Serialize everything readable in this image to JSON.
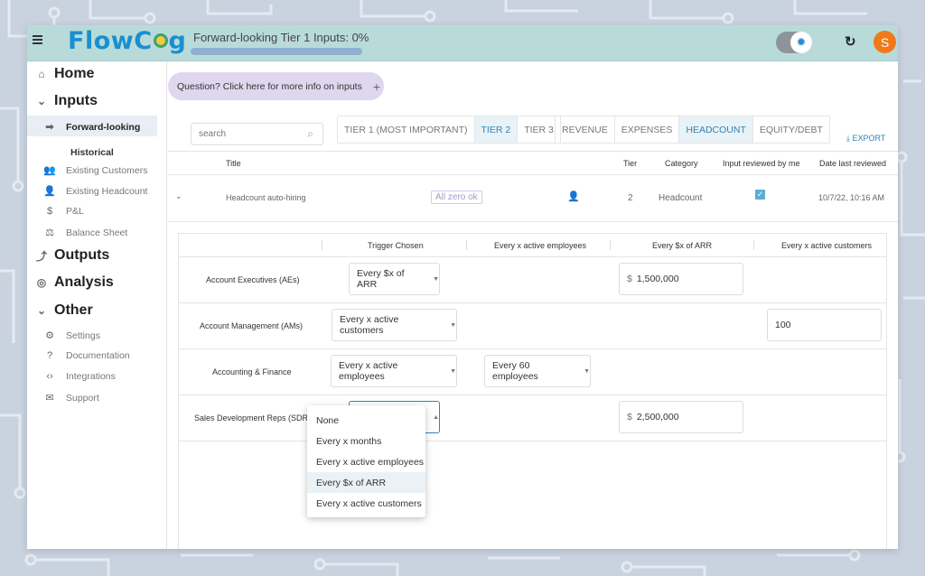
{
  "app": {
    "logo": "FlowCog",
    "progress_title": "Forward-looking Tier 1 Inputs: 0%",
    "progress_value": 0,
    "avatar_initial": "S",
    "icons": {
      "menu": "hamburger-icon",
      "theme": "sun-icon",
      "refresh": "refresh-icon"
    }
  },
  "sidebar": {
    "home": "Home",
    "inputs": "Inputs",
    "forward_looking": "Forward-looking",
    "historical_heading": "Historical",
    "historical": [
      {
        "label": "Existing Customers",
        "icon": "customers-icon"
      },
      {
        "label": "Existing Headcount",
        "icon": "headcount-icon"
      },
      {
        "label": "P&L",
        "icon": "dollar-icon"
      },
      {
        "label": "Balance Sheet",
        "icon": "scale-icon"
      }
    ],
    "outputs": "Outputs",
    "analysis": "Analysis",
    "other": "Other",
    "other_items": [
      {
        "label": "Settings",
        "icon": "gear-icon"
      },
      {
        "label": "Documentation",
        "icon": "help-icon"
      },
      {
        "label": "Integrations",
        "icon": "code-icon"
      },
      {
        "label": "Support",
        "icon": "mail-icon"
      }
    ]
  },
  "main": {
    "question": "Question? Click here for more info on inputs",
    "search_placeholder": "search",
    "tier_tabs": [
      "TIER 1 (MOST IMPORTANT)",
      "TIER 2",
      "TIER 3"
    ],
    "active_tier": "TIER 2",
    "category_tabs": [
      "REVENUE",
      "EXPENSES",
      "HEADCOUNT",
      "EQUITY/DEBT"
    ],
    "active_category": "HEADCOUNT",
    "export": "EXPORT",
    "columns": {
      "title": "Title",
      "tier": "Tier",
      "category": "Category",
      "reviewed": "Input reviewed by me",
      "date": "Date last reviewed"
    },
    "row": {
      "title": "Headcount auto-hiring",
      "badge": "All zero ok",
      "tier": "2",
      "category": "Headcount",
      "reviewed": true,
      "date": "10/7/22, 10:16 AM"
    },
    "sub_columns": [
      "Trigger Chosen",
      "Every x active employees",
      "Every $x of ARR",
      "Every x active customers"
    ],
    "sub_rows": [
      {
        "label": "Account Executives (AEs)",
        "trigger": "Every $x of ARR",
        "arr": "1,500,000"
      },
      {
        "label": "Account Management (AMs)",
        "trigger": "Every x active customers",
        "customers": "100"
      },
      {
        "label": "Accounting & Finance",
        "trigger": "Every x active employees",
        "employees": "Every 60 employees"
      },
      {
        "label": "Sales Development Reps (SDRs)",
        "trigger": "Every $x of ARR",
        "arr": "2,500,000"
      }
    ],
    "currency_symbol": "$",
    "dropdown_options": [
      "None",
      "Every x months",
      "Every x active employees",
      "Every $x of ARR",
      "Every x active customers"
    ],
    "dropdown_selected": "Every $x of ARR"
  }
}
